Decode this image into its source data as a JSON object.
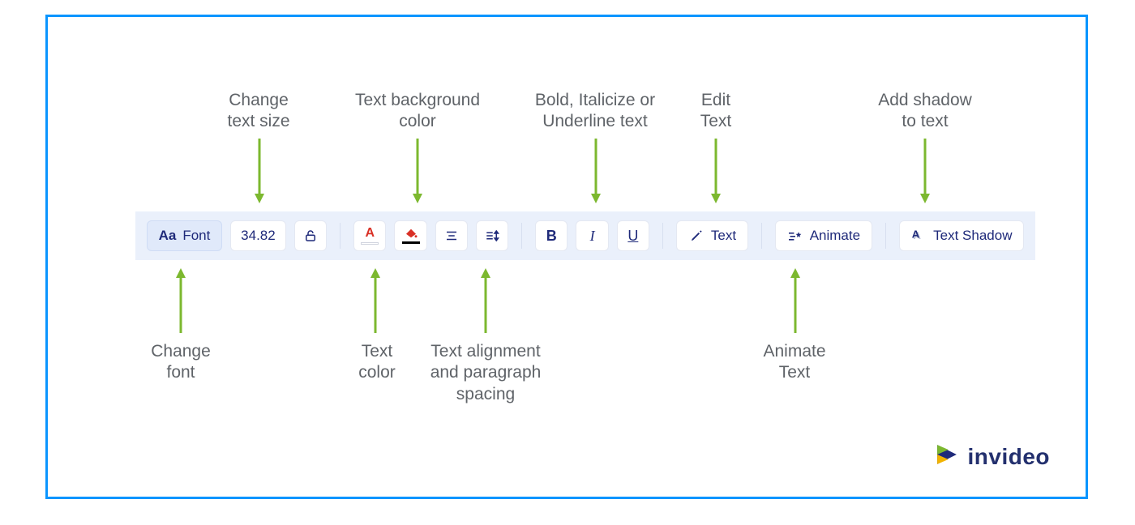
{
  "callouts": {
    "top": {
      "change_text_size": "Change\ntext size",
      "text_bg_color": "Text background\ncolor",
      "bold_italic_underline": "Bold, Italicize or\nUnderline text",
      "edit_text": "Edit\nText",
      "add_shadow": "Add shadow\nto text"
    },
    "bottom": {
      "change_font": "Change\nfont",
      "text_color": "Text\ncolor",
      "alignment_spacing": "Text alignment\nand paragraph\nspacing",
      "animate_text": "Animate\nText"
    }
  },
  "toolbar": {
    "font_prefix": "Aa",
    "font_label": "Font",
    "size_value": "34.82",
    "edit_text_label": "Text",
    "animate_label": "Animate",
    "shadow_label": "Text Shadow"
  },
  "branding": {
    "name": "invideo"
  },
  "colors": {
    "accent_red": "#d93025",
    "accent_black": "#000000",
    "toolbar_text": "#1f2a7a",
    "callout_green": "#7cb82f"
  }
}
